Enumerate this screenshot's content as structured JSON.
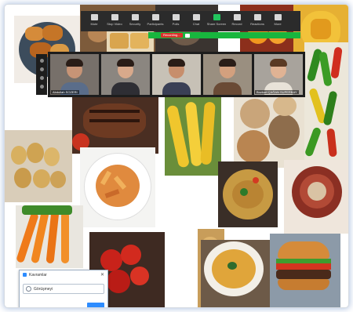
{
  "zoom_toolbar": {
    "buttons": [
      {
        "label": "Mute",
        "icon": "microphone-icon"
      },
      {
        "label": "Stop Video",
        "icon": "video-camera-icon"
      },
      {
        "label": "Security",
        "icon": "shield-icon"
      },
      {
        "label": "Participants",
        "icon": "participants-icon"
      },
      {
        "label": "Polls",
        "icon": "polls-icon"
      },
      {
        "label": "Chat",
        "icon": "chat-icon"
      },
      {
        "label": "Share Screen",
        "icon": "share-screen-icon"
      },
      {
        "label": "Record",
        "icon": "record-icon"
      },
      {
        "label": "Reactions",
        "icon": "reactions-icon"
      },
      {
        "label": "More",
        "icon": "more-icon"
      }
    ],
    "recording_label": "Recording...",
    "accent": "#18b63e",
    "record_color": "#d9312b"
  },
  "participants": [
    {
      "name": "Abdullah SOZERI"
    },
    {
      "name": ""
    },
    {
      "name": ""
    },
    {
      "name": ""
    },
    {
      "name": "Bozkurt ÇAĞAN SUPERBAY"
    }
  ],
  "dialog": {
    "title": "Kavramlar",
    "input_value": "Görüşmeyi",
    "accent": "#2d8cff"
  },
  "food_tiles": [
    "fried-chicken",
    "bread-rolls",
    "waffles",
    "oranges",
    "mango",
    "green-chili-peppers",
    "grilled-steak",
    "corn-cobs",
    "bread-loaves",
    "potatoes",
    "penne-pasta",
    "spaghetti",
    "kidney-beans",
    "carrots",
    "tomatoes",
    "lentil-soup",
    "onion-rings",
    "hamburger"
  ]
}
